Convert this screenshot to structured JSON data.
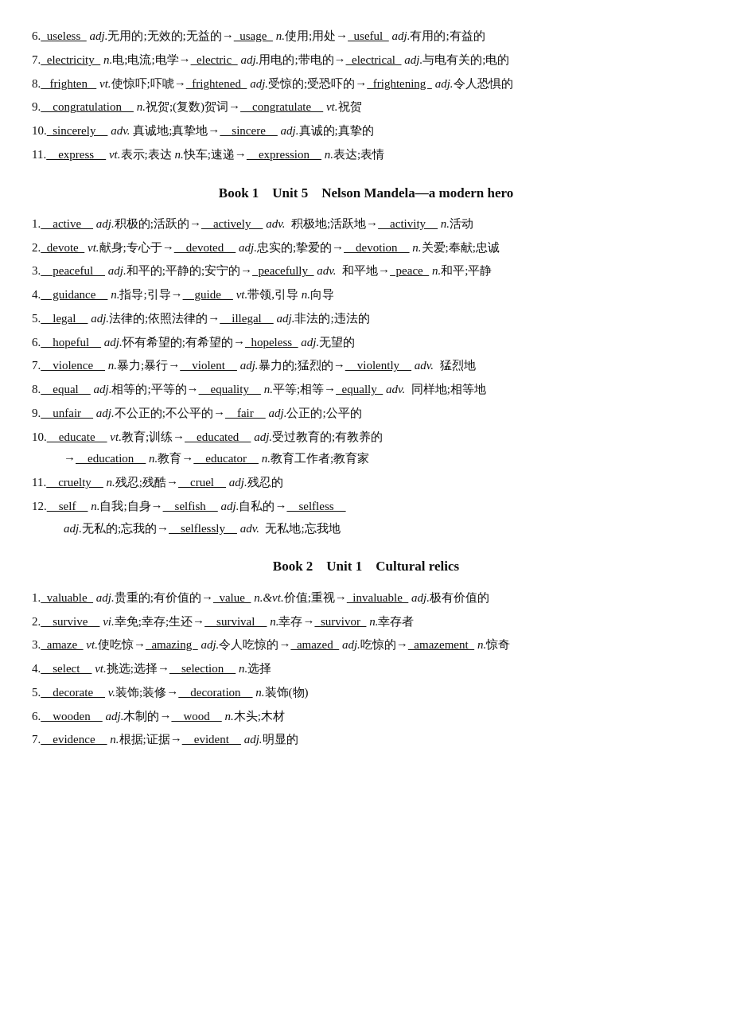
{
  "sections": [
    {
      "id": "top-entries",
      "title": null,
      "entries": [
        {
          "num": "6.",
          "html": "6.<span class='underline'>&nbsp;&nbsp;useless&nbsp;&nbsp;</span> <em>adj.</em>无用的;无效的;无益的→<span class='underline'>&nbsp;&nbsp;usage&nbsp;&nbsp;</span> <em>n.</em>使用;用处→<span class='underline'>&nbsp;&nbsp;useful&nbsp;&nbsp;</span> <em>adj.</em>有用的;有益的"
        },
        {
          "num": "7.",
          "html": "7.<span class='underline'>&nbsp;&nbsp;electricity&nbsp;&nbsp;</span> <em>n.</em>电;电流;电学→<span class='underline'>&nbsp;&nbsp;electric&nbsp;&nbsp;</span> <em>adj.</em>用电的;带电的→<span class='underline'>&nbsp;&nbsp;electrical&nbsp;&nbsp;</span> <em>adj.</em>与电有关的;电的"
        },
        {
          "num": "8.",
          "html": "8.<span class='underline'>&nbsp;&nbsp;&nbsp;frighten&nbsp;&nbsp;&nbsp;</span> <em>vt.</em>使惊吓;吓唬→<span class='underline'>&nbsp;&nbsp;frightened&nbsp;&nbsp;</span> <em>adj.</em>受惊的;受恐吓的→<span class='underline'>&nbsp;&nbsp;frightening&nbsp;&nbsp;</span> <em>adj.</em>令人恐惧的"
        },
        {
          "num": "9.",
          "html": "9.<span class='underline'>&nbsp;&nbsp;&nbsp;&nbsp;congratulation&nbsp;&nbsp;&nbsp;&nbsp;</span> <em>n.</em>祝贺;(复数)贺词→<span class='underline'>&nbsp;&nbsp;&nbsp;&nbsp;congratulate&nbsp;&nbsp;&nbsp;&nbsp;</span> <em>vt.</em>祝贺"
        },
        {
          "num": "10.",
          "html": "10.<span class='underline'>&nbsp;&nbsp;sincerely&nbsp;&nbsp;&nbsp;&nbsp;</span> <em>adv.</em> 真诚地;真挚地→<span class='underline'>&nbsp;&nbsp;&nbsp;&nbsp;sincere&nbsp;&nbsp;&nbsp;&nbsp;</span> <em>adj.</em>真诚的;真挚的"
        },
        {
          "num": "11.",
          "html": "11.<span class='underline'>&nbsp;&nbsp;&nbsp;&nbsp;express&nbsp;&nbsp;&nbsp;&nbsp;</span> <em>vt.</em>表示;表达 <em>n.</em>快车;速递→<span class='underline'>&nbsp;&nbsp;&nbsp;&nbsp;expression&nbsp;&nbsp;&nbsp;&nbsp;</span> <em>n.</em>表达;表情"
        }
      ]
    },
    {
      "id": "book1-unit5",
      "title": "Book 1    Unit 5    Nelson Mandela—a modern hero",
      "entries": [
        {
          "html": "1.<span class='underline'>&nbsp;&nbsp;&nbsp;&nbsp;active&nbsp;&nbsp;&nbsp;&nbsp;</span> <em>adj.</em>积极的;活跃的→<span class='underline'>&nbsp;&nbsp;&nbsp;&nbsp;actively&nbsp;&nbsp;&nbsp;&nbsp;</span> <em>adv.</em>  积极地;活跃地→<span class='underline'>&nbsp;&nbsp;&nbsp;&nbsp;activity&nbsp;&nbsp;&nbsp;&nbsp;</span> <em>n.</em>活动"
        },
        {
          "html": "2.<span class='underline'>&nbsp;&nbsp;devote&nbsp;&nbsp;</span> <em>vt.</em>献身;专心于→<span class='underline'>&nbsp;&nbsp;&nbsp;&nbsp;devoted&nbsp;&nbsp;&nbsp;&nbsp;</span> <em>adj.</em>忠实的;挚爱的→<span class='underline'>&nbsp;&nbsp;&nbsp;&nbsp;devotion&nbsp;&nbsp;&nbsp;&nbsp;</span> <em>n.</em>关爱;奉献;忠诚"
        },
        {
          "html": "3.<span class='underline'>&nbsp;&nbsp;&nbsp;&nbsp;peaceful&nbsp;&nbsp;&nbsp;&nbsp;</span> <em>adj.</em>和平的;平静的;安宁的→<span class='underline'>&nbsp;&nbsp;peacefully&nbsp;&nbsp;</span> <em>adv.</em>  和平地→<span class='underline'>&nbsp;&nbsp;peace&nbsp;&nbsp;</span> <em>n.</em>和平;平静"
        },
        {
          "html": "4.<span class='underline'>&nbsp;&nbsp;&nbsp;&nbsp;guidance&nbsp;&nbsp;&nbsp;&nbsp;</span> <em>n.</em>指导;引导→<span class='underline'>&nbsp;&nbsp;&nbsp;&nbsp;guide&nbsp;&nbsp;&nbsp;&nbsp;</span> <em>vt.</em>带领,引导 <em>n.</em>向导"
        },
        {
          "html": "5.<span class='underline'>&nbsp;&nbsp;&nbsp;&nbsp;legal&nbsp;&nbsp;&nbsp;&nbsp;</span> <em>adj.</em>法律的;依照法律的→<span class='underline'>&nbsp;&nbsp;&nbsp;&nbsp;illegal&nbsp;&nbsp;&nbsp;&nbsp;</span> <em>adj.</em>非法的;违法的"
        },
        {
          "html": "6.<span class='underline'>&nbsp;&nbsp;&nbsp;&nbsp;hopeful&nbsp;&nbsp;&nbsp;&nbsp;</span> <em>adj.</em>怀有希望的;有希望的→<span class='underline'>&nbsp;&nbsp;hopeless&nbsp;&nbsp;</span> <em>adj.</em>无望的"
        },
        {
          "html": "7.<span class='underline'>&nbsp;&nbsp;&nbsp;&nbsp;violence&nbsp;&nbsp;&nbsp;&nbsp;</span> <em>n.</em>暴力;暴行→<span class='underline'>&nbsp;&nbsp;&nbsp;&nbsp;violent&nbsp;&nbsp;&nbsp;&nbsp;</span> <em>adj.</em>暴力的;猛烈的→<span class='underline'>&nbsp;&nbsp;&nbsp;&nbsp;violently&nbsp;&nbsp;&nbsp;&nbsp;</span> <em>adv.</em>  猛烈地"
        },
        {
          "html": "8.<span class='underline'>&nbsp;&nbsp;&nbsp;&nbsp;equal&nbsp;&nbsp;&nbsp;&nbsp;</span> <em>adj.</em>相等的;平等的→<span class='underline'>&nbsp;&nbsp;&nbsp;&nbsp;equality&nbsp;&nbsp;&nbsp;&nbsp;</span> <em>n.</em>平等;相等→<span class='underline'>&nbsp;&nbsp;equally&nbsp;&nbsp;</span> <em>adv.</em>  同样地;相等地"
        },
        {
          "html": "9.<span class='underline'>&nbsp;&nbsp;&nbsp;&nbsp;unfair&nbsp;&nbsp;&nbsp;&nbsp;</span> <em>adj.</em>不公正的;不公平的→<span class='underline'>&nbsp;&nbsp;&nbsp;&nbsp;fair&nbsp;&nbsp;&nbsp;&nbsp;</span> <em>adj.</em>公正的;公平的"
        },
        {
          "html": "10.<span class='underline'>&nbsp;&nbsp;&nbsp;&nbsp;educate&nbsp;&nbsp;&nbsp;&nbsp;</span> <em>vt.</em>教育;训练→<span class='underline'>&nbsp;&nbsp;&nbsp;&nbsp;educated&nbsp;&nbsp;&nbsp;&nbsp;</span> <em>adj.</em>受过教育的;有教养的"
        },
        {
          "html": "&nbsp;&nbsp;&nbsp;&nbsp;→<span class='underline'>&nbsp;&nbsp;&nbsp;&nbsp;education&nbsp;&nbsp;&nbsp;&nbsp;</span> <em>n.</em>教育→<span class='underline'>&nbsp;&nbsp;&nbsp;&nbsp;educator&nbsp;&nbsp;&nbsp;&nbsp;</span> <em>n.</em>教育工作者;教育家",
          "indent": true
        },
        {
          "html": "11.<span class='underline'>&nbsp;&nbsp;&nbsp;&nbsp;cruelty&nbsp;&nbsp;&nbsp;&nbsp;</span> <em>n.</em>残忍;残酷→<span class='underline'>&nbsp;&nbsp;&nbsp;&nbsp;cruel&nbsp;&nbsp;&nbsp;&nbsp;</span> <em>adj.</em>残忍的"
        },
        {
          "html": "12.<span class='underline'>&nbsp;&nbsp;&nbsp;&nbsp;self&nbsp;&nbsp;&nbsp;&nbsp;</span> <em>n.</em>自我;自身→<span class='underline'>&nbsp;&nbsp;&nbsp;&nbsp;selfish&nbsp;&nbsp;&nbsp;&nbsp;</span> <em>adj.</em>自私的→<span class='underline'>&nbsp;&nbsp;&nbsp;&nbsp;selfless&nbsp;&nbsp;&nbsp;&nbsp;</span>"
        },
        {
          "html": "&nbsp;&nbsp;&nbsp;&nbsp;<em>adj.</em>无私的;忘我的→<span class='underline'>&nbsp;&nbsp;&nbsp;&nbsp;selflessly&nbsp;&nbsp;&nbsp;&nbsp;</span> <em>adv.</em>  无私地;忘我地",
          "indent": true
        }
      ]
    },
    {
      "id": "book2-unit1",
      "title": "Book 2    Unit 1    Cultural relics",
      "entries": [
        {
          "html": "1.<span class='underline'>&nbsp;&nbsp;valuable&nbsp;&nbsp;</span> <em>adj.</em>贵重的;有价值的→<span class='underline'>&nbsp;&nbsp;value&nbsp;&nbsp;</span> <em>n.&amp;vt.</em>价值;重视→<span class='underline'>&nbsp;&nbsp;invaluable&nbsp;&nbsp;</span> <em>adj.</em>极有价值的"
        },
        {
          "html": "2.<span class='underline'>&nbsp;&nbsp;&nbsp;&nbsp;survive&nbsp;&nbsp;&nbsp;&nbsp;</span> <em>vi.</em>幸免;幸存;生还→<span class='underline'>&nbsp;&nbsp;&nbsp;&nbsp;survival&nbsp;&nbsp;&nbsp;&nbsp;</span> <em>n.</em>幸存→<span class='underline'>&nbsp;&nbsp;survivor&nbsp;&nbsp;</span> <em>n.</em>幸存者"
        },
        {
          "html": "3.<span class='underline'>&nbsp;&nbsp;amaze&nbsp;&nbsp;</span> <em>vt.</em>使吃惊→<span class='underline'>&nbsp;&nbsp;amazing&nbsp;&nbsp;</span> <em>adj.</em>令人吃惊的→<span class='underline'>&nbsp;&nbsp;amazed&nbsp;&nbsp;</span> <em>adj.</em>吃惊的→<span class='underline'>&nbsp;&nbsp;amazement&nbsp;&nbsp;</span> <em>n.</em>惊奇"
        },
        {
          "html": "4.<span class='underline'>&nbsp;&nbsp;&nbsp;&nbsp;select&nbsp;&nbsp;&nbsp;&nbsp;</span> <em>vt.</em>挑选;选择→<span class='underline'>&nbsp;&nbsp;&nbsp;&nbsp;selection&nbsp;&nbsp;&nbsp;&nbsp;</span> <em>n.</em>选择"
        },
        {
          "html": "5.<span class='underline'>&nbsp;&nbsp;&nbsp;&nbsp;decorate&nbsp;&nbsp;&nbsp;&nbsp;</span> <em>v.</em>装饰;装修→<span class='underline'>&nbsp;&nbsp;&nbsp;&nbsp;decoration&nbsp;&nbsp;&nbsp;&nbsp;</span> <em>n.</em>装饰(物)"
        },
        {
          "html": "6.<span class='underline'>&nbsp;&nbsp;&nbsp;&nbsp;wooden&nbsp;&nbsp;&nbsp;&nbsp;</span> <em>adj.</em>木制的→<span class='underline'>&nbsp;&nbsp;&nbsp;&nbsp;wood&nbsp;&nbsp;&nbsp;&nbsp;</span> <em>n.</em>木头;木材"
        },
        {
          "html": "7.<span class='underline'>&nbsp;&nbsp;&nbsp;&nbsp;evidence&nbsp;&nbsp;&nbsp;&nbsp;</span> <em>n.</em>根据;证据→<span class='underline'>&nbsp;&nbsp;&nbsp;&nbsp;evident&nbsp;&nbsp;&nbsp;&nbsp;</span> <em>adj.</em>明显的"
        }
      ]
    }
  ]
}
